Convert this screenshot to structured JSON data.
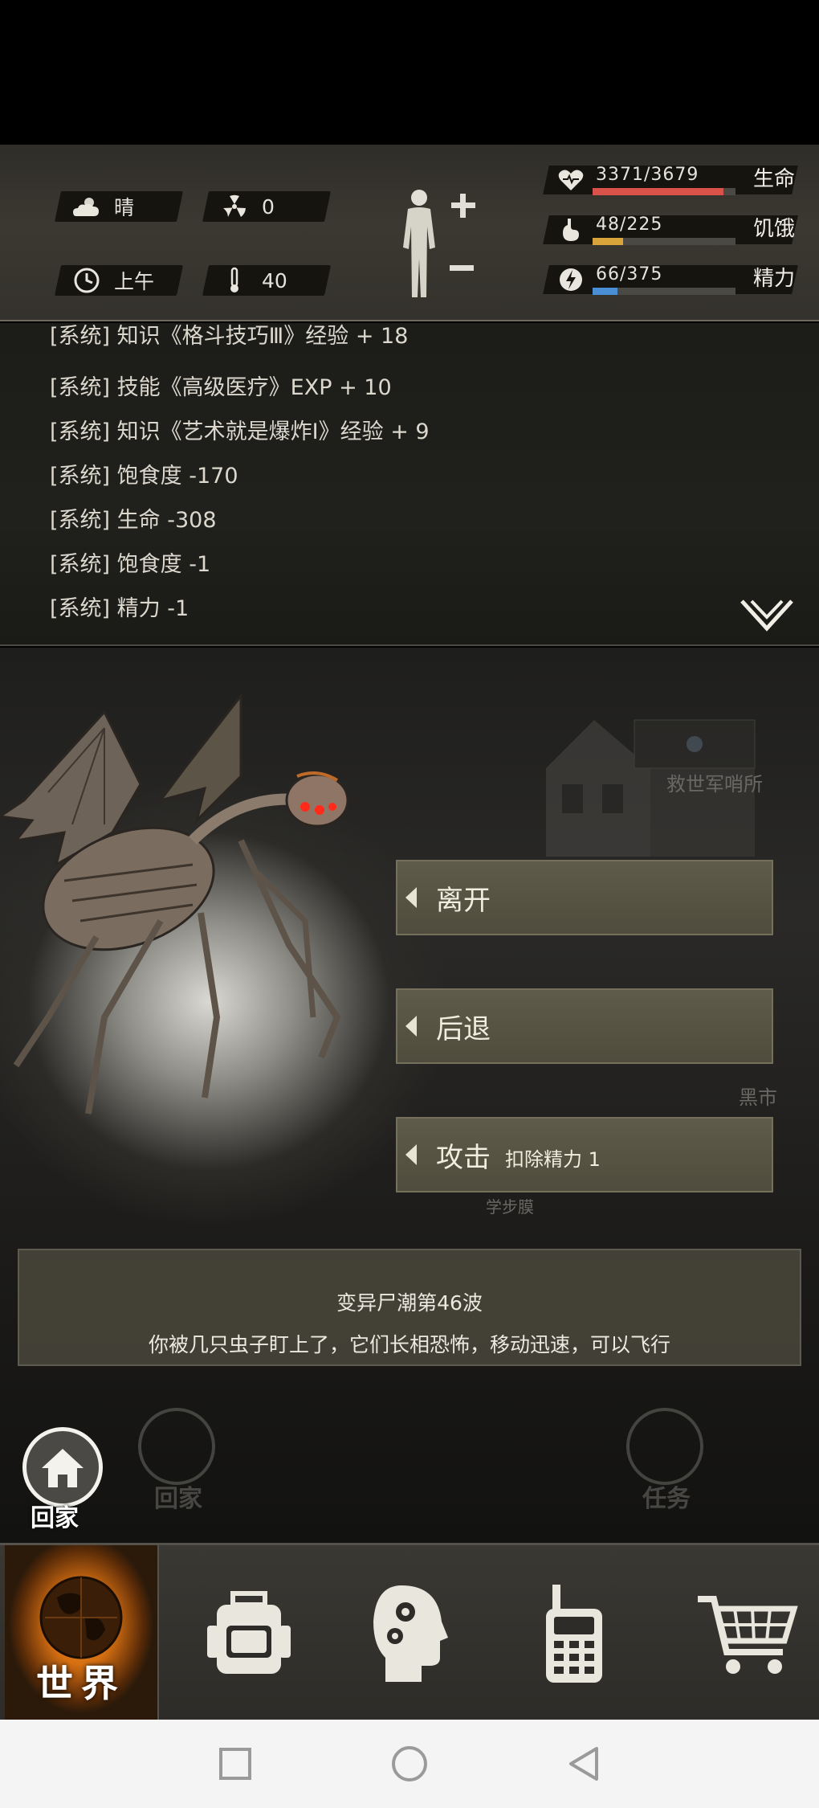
{
  "status": {
    "weather": "晴",
    "radiation": "0",
    "time_of_day": "上午",
    "temperature": "40",
    "stats": [
      {
        "value": "3371/3679",
        "label": "生命",
        "fraction": 0.916,
        "color": "#d9534a"
      },
      {
        "value": "48/225",
        "label": "饥饿",
        "fraction": 0.213,
        "color": "#d9a53a"
      },
      {
        "value": "66/375",
        "label": "精力",
        "fraction": 0.176,
        "color": "#4a8fd6"
      }
    ]
  },
  "log": {
    "lines": [
      "[系统] 知识《格斗技巧Ⅲ》经验 + 18",
      "[系统] 技能《高级医疗》EXP + 10",
      "[系统] 知识《艺术就是爆炸Ⅰ》经验 + 9",
      "[系统] 饱食度 -170",
      "[系统] 生命 -308",
      "[系统] 饱食度 -1",
      "[系统] 精力 -1"
    ]
  },
  "scene": {
    "bg_labels": [
      "救世军哨所",
      "黑市",
      "学步膜"
    ],
    "actions": [
      {
        "label": "离开",
        "sub": ""
      },
      {
        "label": "后退",
        "sub": ""
      },
      {
        "label": "攻击",
        "sub": "扣除精力 1"
      }
    ],
    "event": {
      "title": "变异尸潮第46波",
      "description": "你被几只虫子盯上了，它们长相恐怖，移动迅速，可以飞行"
    },
    "home_label": "回家",
    "ghost_home_label": "回家",
    "ghost_task_label": "任务"
  },
  "nav": {
    "world_label": "世界",
    "icons": [
      "globe-icon",
      "backpack-icon",
      "brain-gears-icon",
      "radio-icon",
      "cart-icon"
    ]
  }
}
